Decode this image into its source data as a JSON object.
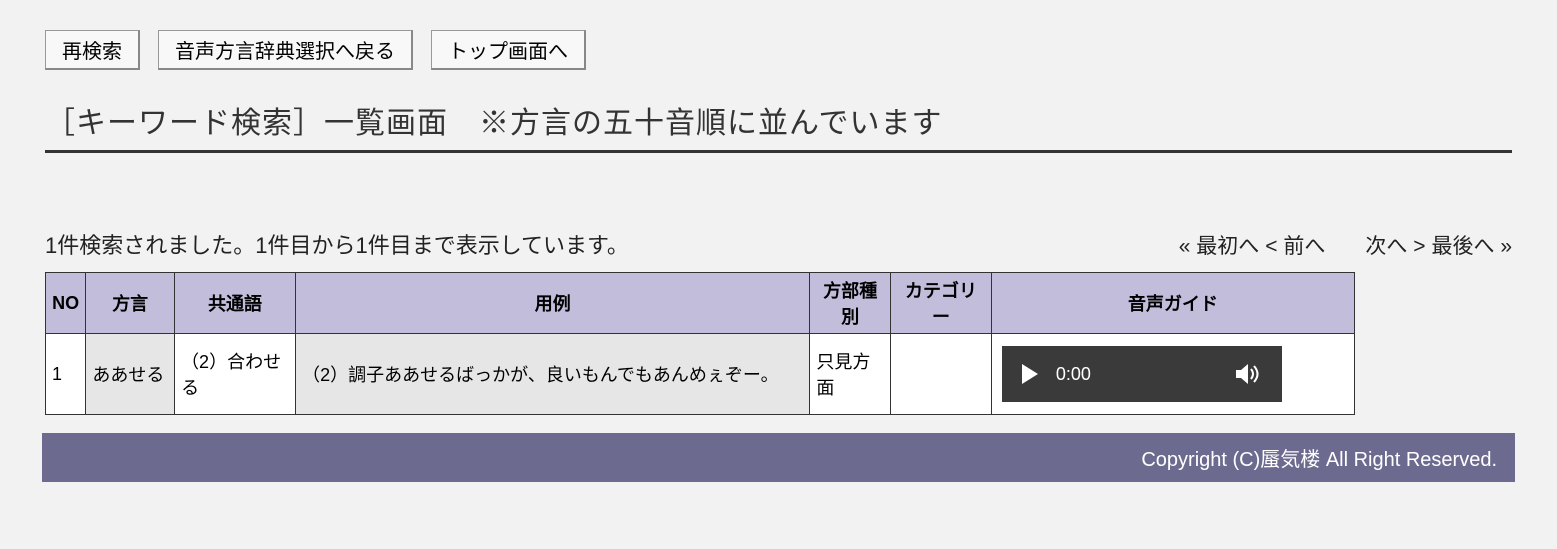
{
  "buttons": {
    "research": "再検索",
    "back_to_dict": "音声方言辞典選択へ戻る",
    "to_top": "トップ画面へ"
  },
  "title": "［キーワード検索］一覧画面　※方言の五十音順に並んでいます",
  "results_text": "1件検索されました。1件目から1件目まで表示しています。",
  "pager": {
    "first": "« 最初へ",
    "prev": "< 前へ",
    "next": "次へ >",
    "last": "最後へ »"
  },
  "headers": {
    "no": "NO",
    "dialect": "方言",
    "common": "共通語",
    "example": "用例",
    "type": "方部種別",
    "category": "カテゴリー",
    "audio": "音声ガイド"
  },
  "rows": [
    {
      "no": "1",
      "dialect": "ああせる",
      "common": "（2）合わせる",
      "example": "（2）調子ああせるばっかが、良いもんでもあんめぇぞー。",
      "type": "只見方面",
      "category": "",
      "audio_time": "0:00"
    }
  ],
  "footer": "Copyright (C)蜃気楼  All Right Reserved."
}
